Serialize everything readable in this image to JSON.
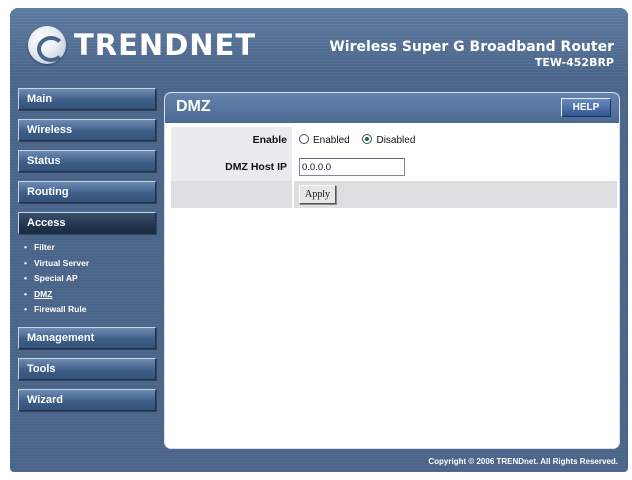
{
  "header": {
    "logo_text": "TRENDNET",
    "product_name": "Wireless Super G Broadband Router",
    "model": "TEW-452BRP"
  },
  "sidebar": {
    "items": [
      {
        "label": "Main"
      },
      {
        "label": "Wireless"
      },
      {
        "label": "Status"
      },
      {
        "label": "Routing"
      },
      {
        "label": "Access"
      },
      {
        "label": "Management"
      },
      {
        "label": "Tools"
      },
      {
        "label": "Wizard"
      }
    ],
    "active": "Access",
    "access_submenu": [
      {
        "label": "Filter"
      },
      {
        "label": "Virtual Server"
      },
      {
        "label": "Special AP"
      },
      {
        "label": "DMZ"
      },
      {
        "label": "Firewall Rule"
      }
    ],
    "current_submenu": "DMZ"
  },
  "panel": {
    "title": "DMZ",
    "help_label": "HELP",
    "enable_label": "Enable",
    "enable_options": [
      {
        "label": "Enabled",
        "selected": false
      },
      {
        "label": "Disabled",
        "selected": true
      }
    ],
    "host_ip_label": "DMZ Host IP",
    "host_ip_value": "0.0.0.0",
    "apply_label": "Apply"
  },
  "footer": {
    "copyright": "Copyright © 2006 TRENDnet. All Rights Reserved."
  },
  "colors": {
    "frame_bg": "#4a6589",
    "nav_button": "#3f5f88",
    "nav_active": "#23354f",
    "panel_header": "#5873a0"
  }
}
